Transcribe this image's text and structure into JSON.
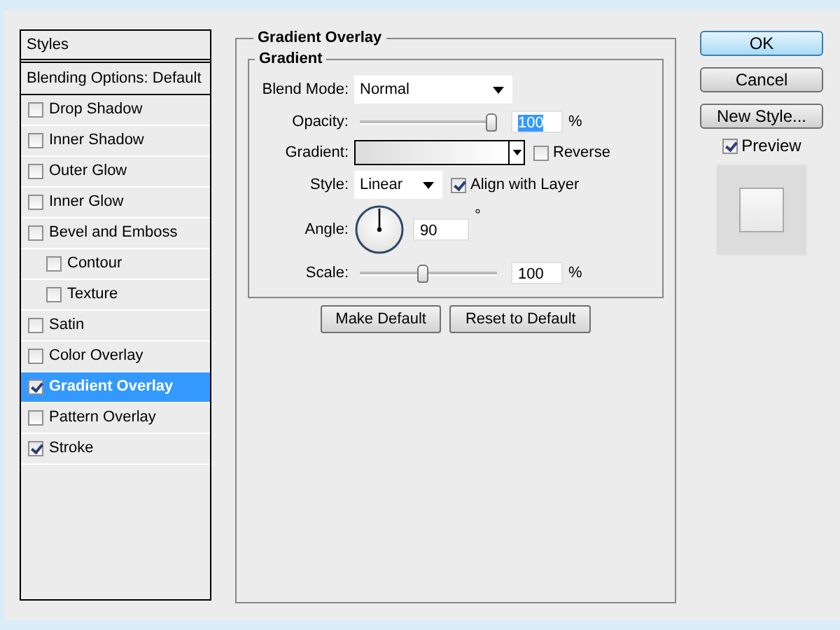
{
  "styles_panel": {
    "header": "Styles",
    "blending": "Blending Options: Default",
    "items": [
      {
        "label": "Drop Shadow",
        "checked": false,
        "selected": false
      },
      {
        "label": "Inner Shadow",
        "checked": false,
        "selected": false
      },
      {
        "label": "Outer Glow",
        "checked": false,
        "selected": false
      },
      {
        "label": "Inner Glow",
        "checked": false,
        "selected": false
      },
      {
        "label": "Bevel and Emboss",
        "checked": false,
        "selected": false,
        "children": [
          {
            "label": "Contour",
            "checked": false,
            "selected": false
          },
          {
            "label": "Texture",
            "checked": false,
            "selected": false
          }
        ]
      },
      {
        "label": "Satin",
        "checked": false,
        "selected": false
      },
      {
        "label": "Color Overlay",
        "checked": false,
        "selected": false
      },
      {
        "label": "Gradient Overlay",
        "checked": true,
        "selected": true
      },
      {
        "label": "Pattern Overlay",
        "checked": false,
        "selected": false
      },
      {
        "label": "Stroke",
        "checked": true,
        "selected": false
      }
    ]
  },
  "gradient_overlay": {
    "title": "Gradient Overlay",
    "group_title": "Gradient",
    "blend_mode": {
      "label": "Blend Mode:",
      "value": "Normal"
    },
    "opacity": {
      "label": "Opacity:",
      "level": 1,
      "value": "100",
      "highlighted": true,
      "unit": "%"
    },
    "gradient": {
      "label": "Gradient:"
    },
    "reverse": {
      "label": "Reverse",
      "checked": false
    },
    "style": {
      "label": "Style:",
      "value": "Linear"
    },
    "align_with_layer": {
      "label": "Align with Layer",
      "checked": true
    },
    "angle": {
      "label": "Angle:",
      "value": "90",
      "unit": "°"
    },
    "scale": {
      "label": "Scale:",
      "level": 0.5,
      "value": "100",
      "unit": "%"
    },
    "buttons": [
      "Make Default",
      "Reset to Default"
    ]
  },
  "actions": {
    "ok": "OK",
    "cancel": "Cancel",
    "new_style": "New Style...",
    "preview": {
      "label": "Preview",
      "checked": true
    }
  }
}
